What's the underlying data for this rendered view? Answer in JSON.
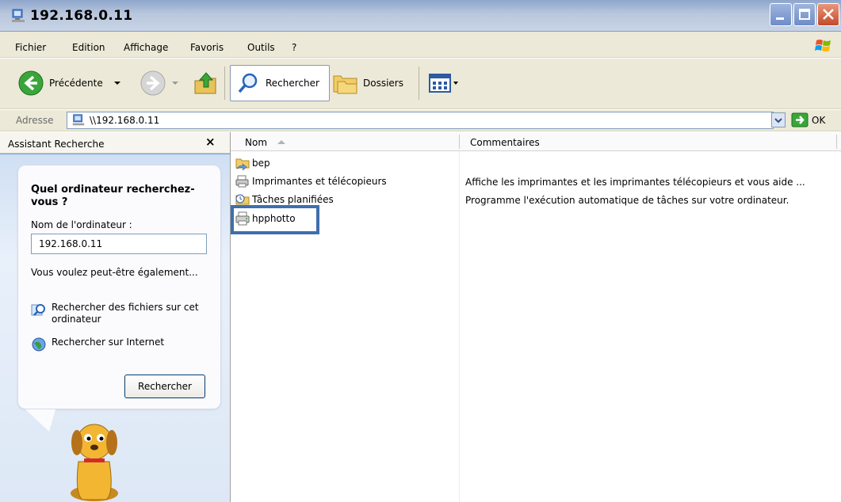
{
  "window": {
    "title": "192.168.0.11"
  },
  "menu": [
    "Fichier",
    "Edition",
    "Affichage",
    "Favoris",
    "Outils",
    "?"
  ],
  "toolbar": {
    "back_label": "Précédente",
    "search_label": "Rechercher",
    "folders_label": "Dossiers"
  },
  "address": {
    "label": "Adresse",
    "value": "\\\\192.168.0.11",
    "go_label": "OK"
  },
  "sidebar": {
    "title": "Assistant Recherche",
    "close_glyph": "×",
    "question": "Quel ordinateur recherchez-vous ?",
    "field_label": "Nom de l'ordinateur :",
    "field_value": "192.168.0.11",
    "suggest": "Vous voulez peut-être également...",
    "link1": "Rechercher des fichiers sur cet ordinateur",
    "link2": "Rechercher sur Internet",
    "search_button": "Rechercher"
  },
  "content": {
    "columns": {
      "name": "Nom",
      "comment": "Commentaires"
    },
    "items": [
      {
        "name": "bep",
        "icon": "shared-folder-icon",
        "comment": ""
      },
      {
        "name": "Imprimantes et télécopieurs",
        "icon": "printer-folder-icon",
        "comment": "Affiche les imprimantes et les imprimantes télécopieurs et vous aide ..."
      },
      {
        "name": "Tâches planifiées",
        "icon": "scheduled-tasks-icon",
        "comment": "Programme l'exécution automatique de tâches sur votre ordinateur."
      },
      {
        "name": "hpphotto",
        "icon": "printer-icon",
        "comment": ""
      }
    ]
  },
  "colors": {
    "highlight": "#3e6fae",
    "sidebar_bg": "#7fa3d9",
    "title_bar": "#b9c7dd"
  }
}
